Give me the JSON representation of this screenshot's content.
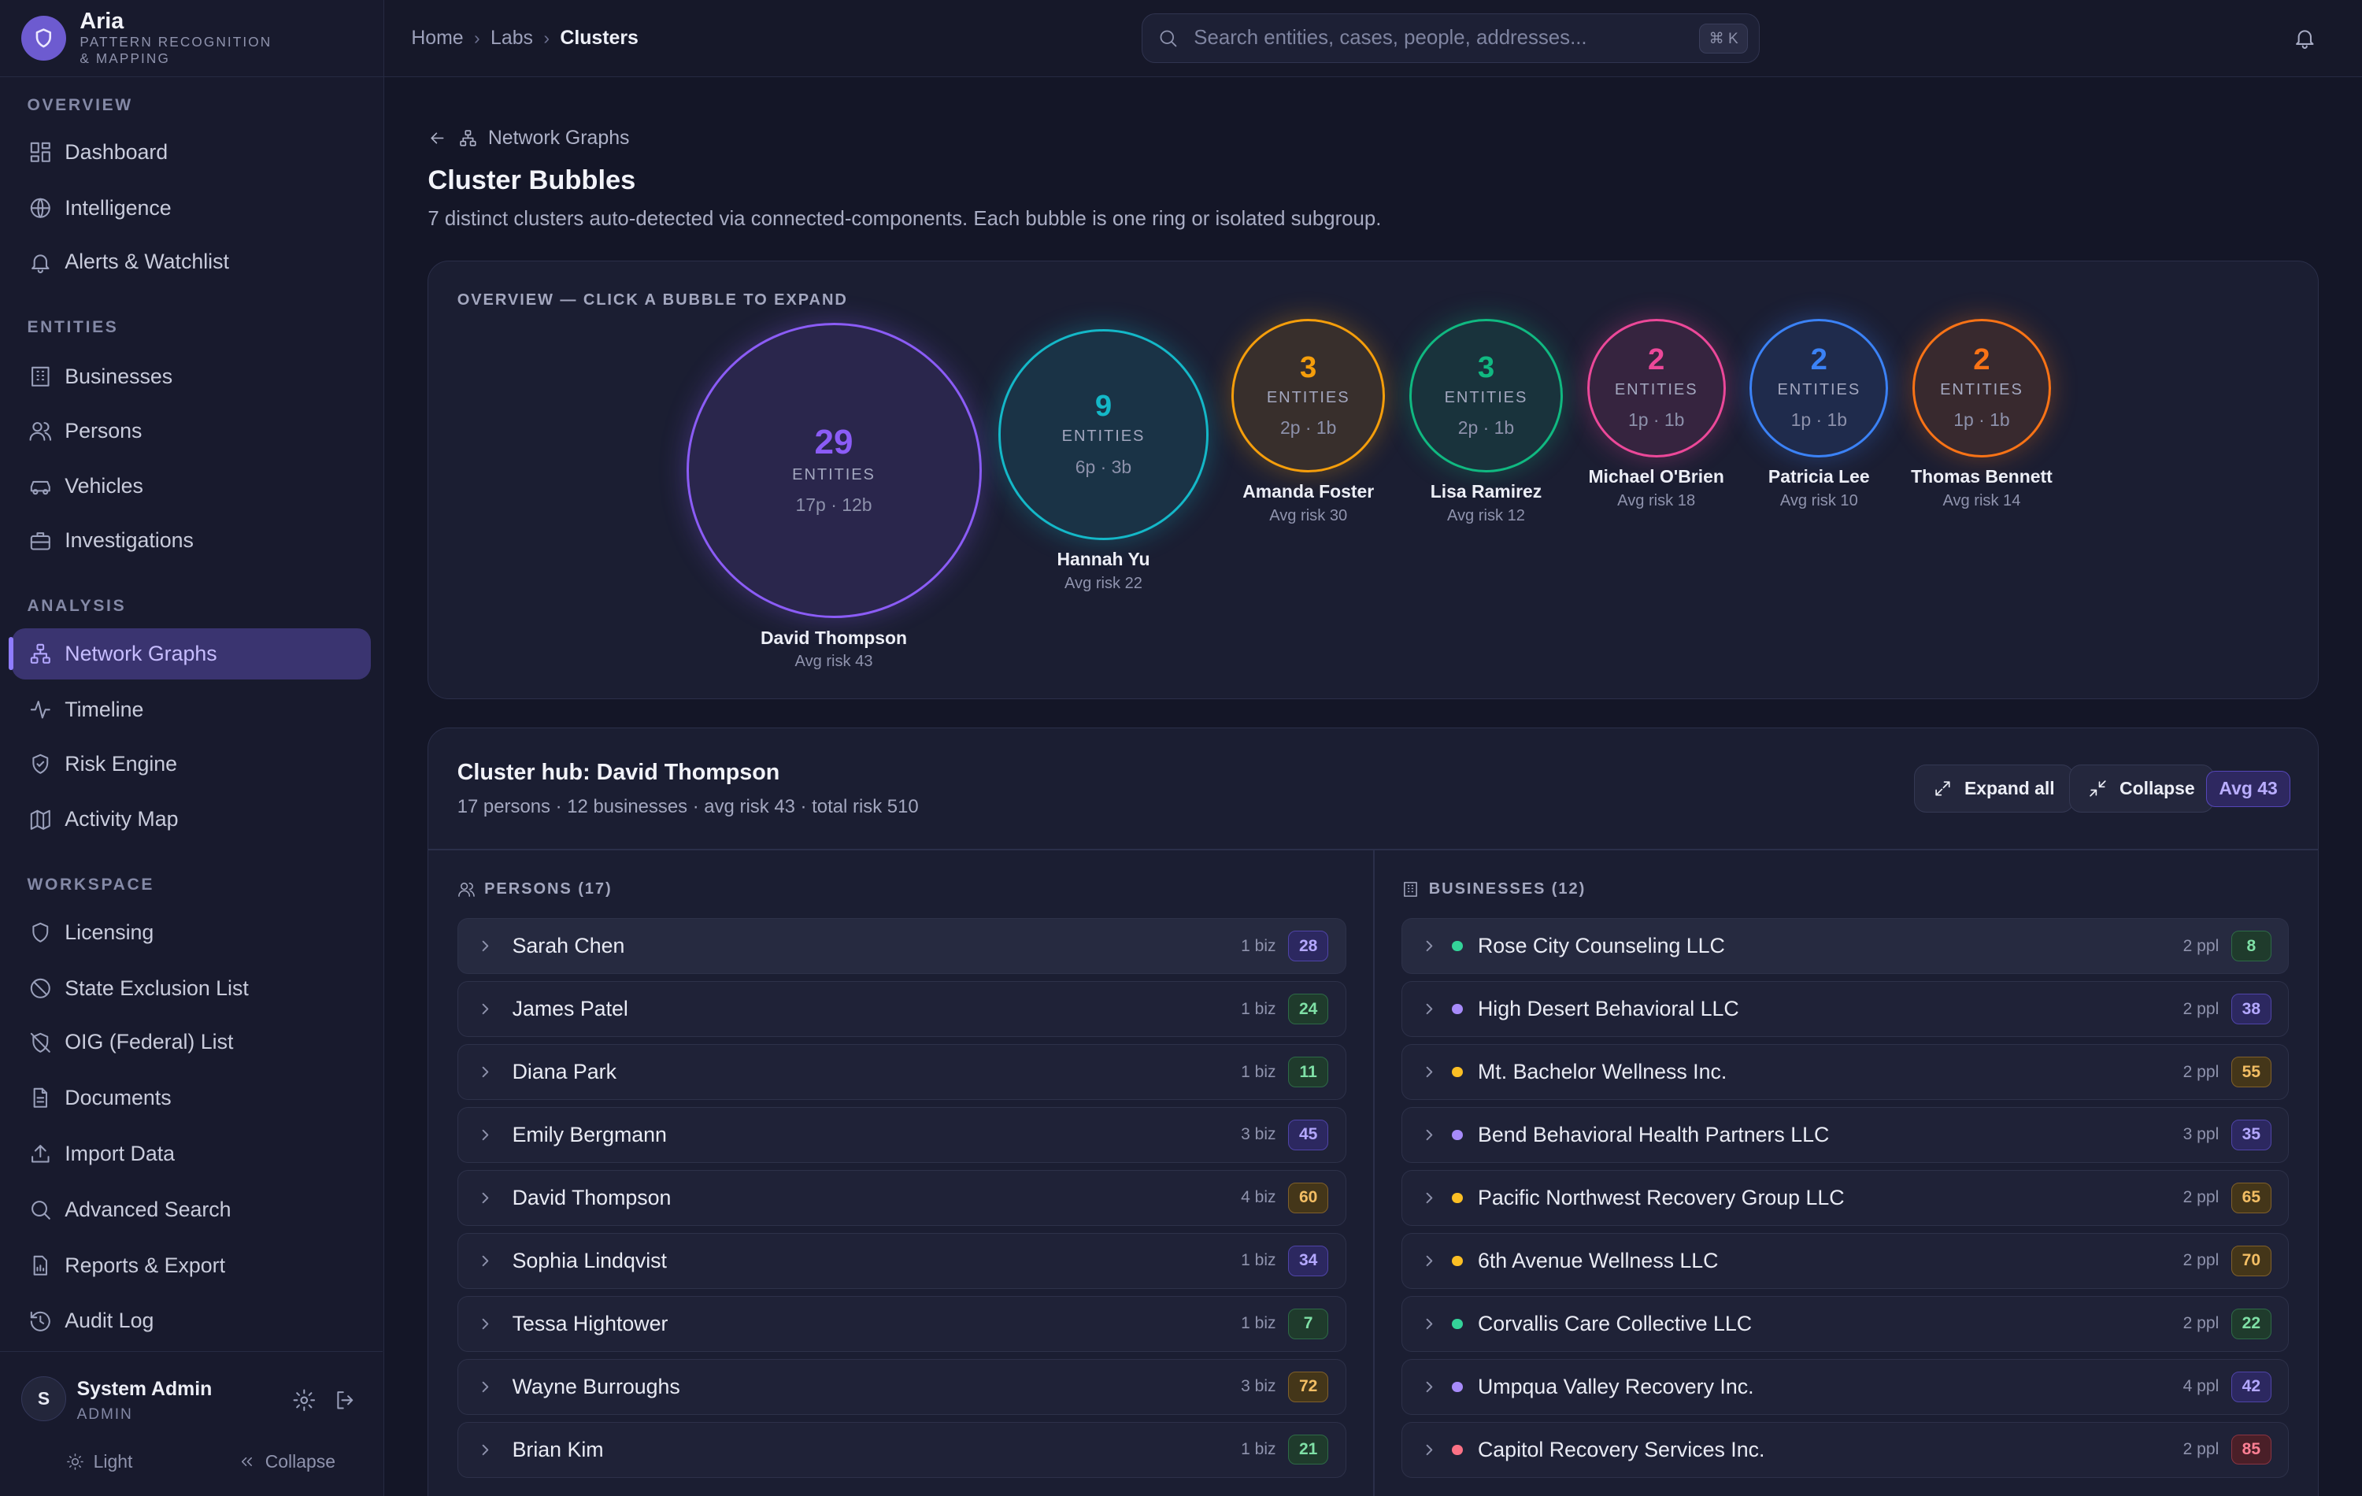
{
  "brand": {
    "name": "Aria",
    "subtitle": "PATTERN RECOGNITION & MAPPING"
  },
  "nav": {
    "sections": [
      "OVERVIEW",
      "ENTITIES",
      "ANALYSIS",
      "WORKSPACE"
    ],
    "items": [
      {
        "label": "Dashboard",
        "icon": "dashboard-icon"
      },
      {
        "label": "Intelligence",
        "icon": "globe-icon"
      },
      {
        "label": "Alerts & Watchlist",
        "icon": "bell-icon"
      },
      {
        "label": "Businesses",
        "icon": "building-icon"
      },
      {
        "label": "Persons",
        "icon": "users-icon"
      },
      {
        "label": "Vehicles",
        "icon": "car-icon"
      },
      {
        "label": "Investigations",
        "icon": "briefcase-icon"
      },
      {
        "label": "Network Graphs",
        "icon": "network-icon",
        "active": true
      },
      {
        "label": "Timeline",
        "icon": "activity-icon"
      },
      {
        "label": "Risk Engine",
        "icon": "shield-check-icon"
      },
      {
        "label": "Activity Map",
        "icon": "map-icon"
      },
      {
        "label": "Licensing",
        "icon": "shield-icon"
      },
      {
        "label": "State Exclusion List",
        "icon": "ban-icon"
      },
      {
        "label": "OIG (Federal) List",
        "icon": "shield-off-icon"
      },
      {
        "label": "Documents",
        "icon": "file-icon"
      },
      {
        "label": "Import Data",
        "icon": "upload-icon"
      },
      {
        "label": "Advanced Search",
        "icon": "search-icon"
      },
      {
        "label": "Reports & Export",
        "icon": "report-icon"
      },
      {
        "label": "Audit Log",
        "icon": "history-icon"
      }
    ]
  },
  "user": {
    "initial": "S",
    "name": "System Admin",
    "role": "ADMIN"
  },
  "footer": {
    "theme_label": "Light",
    "collapse_label": "Collapse"
  },
  "breadcrumb": {
    "home": "Home",
    "labs": "Labs",
    "current": "Clusters"
  },
  "search": {
    "placeholder": "Search entities, cases, people, addresses...",
    "shortcut": "⌘ K"
  },
  "page": {
    "back_label": "Network Graphs",
    "title": "Cluster Bubbles",
    "description": "7 distinct clusters auto-detected via connected-components. Each bubble is one ring or isolated subgroup."
  },
  "overview": {
    "label": "OVERVIEW — CLICK A BUBBLE TO EXPAND",
    "entities_word": "ENTITIES",
    "clusters": [
      {
        "count": "29",
        "mix": "17p · 12b",
        "name": "David Thompson",
        "risk": "Avg risk 43",
        "color": "#8b5cf6"
      },
      {
        "count": "9",
        "mix": "6p · 3b",
        "name": "Hannah Yu",
        "risk": "Avg risk 22",
        "color": "#14b8c8"
      },
      {
        "count": "3",
        "mix": "2p · 1b",
        "name": "Amanda Foster",
        "risk": "Avg risk 30",
        "color": "#f59e0b"
      },
      {
        "count": "3",
        "mix": "2p · 1b",
        "name": "Lisa Ramirez",
        "risk": "Avg risk 12",
        "color": "#10b981"
      },
      {
        "count": "2",
        "mix": "1p · 1b",
        "name": "Michael O'Brien",
        "risk": "Avg risk 18",
        "color": "#ec4899"
      },
      {
        "count": "2",
        "mix": "1p · 1b",
        "name": "Patricia Lee",
        "risk": "Avg risk 10",
        "color": "#3b82f6"
      },
      {
        "count": "2",
        "mix": "1p · 1b",
        "name": "Thomas Bennett",
        "risk": "Avg risk 14",
        "color": "#f97316"
      }
    ]
  },
  "hub": {
    "title": "Cluster hub: David Thompson",
    "subtitle": "17 persons · 12 businesses · avg risk 43 · total risk 510",
    "expand_label": "Expand all",
    "collapse_label": "Collapse",
    "avg_badge": "Avg 43",
    "persons_header": "PERSONS (17)",
    "businesses_header": "BUSINESSES (12)",
    "persons": [
      {
        "name": "Sarah Chen",
        "meta": "1 biz",
        "risk": "28",
        "tone": "purple"
      },
      {
        "name": "James Patel",
        "meta": "1 biz",
        "risk": "24",
        "tone": "green"
      },
      {
        "name": "Diana Park",
        "meta": "1 biz",
        "risk": "11",
        "tone": "green"
      },
      {
        "name": "Emily Bergmann",
        "meta": "3 biz",
        "risk": "45",
        "tone": "purple"
      },
      {
        "name": "David Thompson",
        "meta": "4 biz",
        "risk": "60",
        "tone": "amber"
      },
      {
        "name": "Sophia Lindqvist",
        "meta": "1 biz",
        "risk": "34",
        "tone": "purple"
      },
      {
        "name": "Tessa Hightower",
        "meta": "1 biz",
        "risk": "7",
        "tone": "green"
      },
      {
        "name": "Wayne Burroughs",
        "meta": "3 biz",
        "risk": "72",
        "tone": "amber"
      },
      {
        "name": "Brian Kim",
        "meta": "1 biz",
        "risk": "21",
        "tone": "green"
      }
    ],
    "businesses": [
      {
        "name": "Rose City Counseling LLC",
        "meta": "2 ppl",
        "risk": "8",
        "tone": "green",
        "dot": "#34d399"
      },
      {
        "name": "High Desert Behavioral LLC",
        "meta": "2 ppl",
        "risk": "38",
        "tone": "purple",
        "dot": "#a78bfa"
      },
      {
        "name": "Mt. Bachelor Wellness Inc.",
        "meta": "2 ppl",
        "risk": "55",
        "tone": "amber",
        "dot": "#fbbf24"
      },
      {
        "name": "Bend Behavioral Health Partners LLC",
        "meta": "3 ppl",
        "risk": "35",
        "tone": "purple",
        "dot": "#a78bfa"
      },
      {
        "name": "Pacific Northwest Recovery Group LLC",
        "meta": "2 ppl",
        "risk": "65",
        "tone": "amber",
        "dot": "#fbbf24"
      },
      {
        "name": "6th Avenue Wellness LLC",
        "meta": "2 ppl",
        "risk": "70",
        "tone": "amber",
        "dot": "#fbbf24"
      },
      {
        "name": "Corvallis Care Collective LLC",
        "meta": "2 ppl",
        "risk": "22",
        "tone": "green",
        "dot": "#34d399"
      },
      {
        "name": "Umpqua Valley Recovery Inc.",
        "meta": "4 ppl",
        "risk": "42",
        "tone": "purple",
        "dot": "#a78bfa"
      },
      {
        "name": "Capitol Recovery Services Inc.",
        "meta": "2 ppl",
        "risk": "85",
        "tone": "red",
        "dot": "#fb7185"
      }
    ]
  }
}
